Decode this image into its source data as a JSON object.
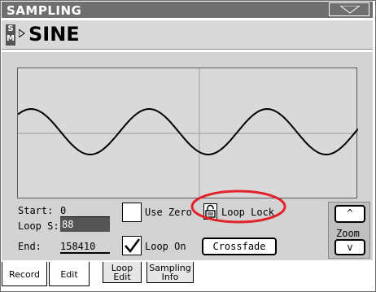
{
  "window": {
    "title": "SAMPLING"
  },
  "sample": {
    "badge_top": "S",
    "badge_bottom": "M",
    "name": "SINE"
  },
  "fields": {
    "start_label": "Start:",
    "start_value": "0",
    "loop_start_label": "Loop S:",
    "loop_start_value": "88",
    "end_label": "End:",
    "end_value": "158410"
  },
  "options": {
    "use_zero_label": "Use Zero",
    "use_zero_checked": false,
    "loop_lock_label": "Loop Lock",
    "loop_on_label": "Loop On",
    "loop_on_checked": true,
    "crossfade_label": "Crossfade"
  },
  "zoom": {
    "up_label": "^",
    "label": "Zoom",
    "down_label": "v"
  },
  "tabs": [
    {
      "line1": "Record",
      "line2": "",
      "active": true
    },
    {
      "line1": "Edit",
      "line2": "",
      "active": true
    },
    {
      "line1": "Loop",
      "line2": "Edit",
      "active": false
    },
    {
      "line1": "Sampling",
      "line2": "Info",
      "active": false
    }
  ],
  "colors": {
    "title_bar": "#6f6f6f",
    "panel": "#d3d3d3",
    "highlight_circle": "#e0242a",
    "selected_field": "#555555"
  }
}
